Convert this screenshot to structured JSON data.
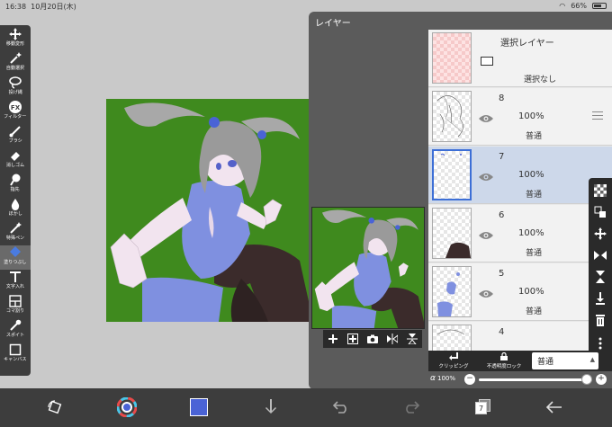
{
  "status_bar": {
    "time": "16:38",
    "date": "10月20日(木)",
    "battery": "66%"
  },
  "toolbar": {
    "items": [
      {
        "icon": "move-icon",
        "label": "移動変形"
      },
      {
        "icon": "magic-wand-icon",
        "label": "自動選択"
      },
      {
        "icon": "lasso-icon",
        "label": "投げ縄"
      },
      {
        "icon": "fx-icon",
        "label": "フィルター"
      },
      {
        "icon": "brush-icon",
        "label": "ブラシ"
      },
      {
        "icon": "eraser-icon",
        "label": "消しゴム"
      },
      {
        "icon": "smudge-icon",
        "label": "指先"
      },
      {
        "icon": "blur-icon",
        "label": "ぼかし"
      },
      {
        "icon": "special-pen-icon",
        "label": "特殊ペン"
      },
      {
        "icon": "fill-icon",
        "label": "塗りつぶし"
      },
      {
        "icon": "text-icon",
        "label": "文字入れ"
      },
      {
        "icon": "frame-divide-icon",
        "label": "コマ割り"
      },
      {
        "icon": "eyedropper-icon",
        "label": "スポイト"
      },
      {
        "icon": "canvas-icon",
        "label": "キャンバス"
      }
    ],
    "active_index": 9
  },
  "layer_panel": {
    "title": "レイヤー",
    "selection_layer": {
      "title": "選択レイヤー",
      "status": "選択なし"
    },
    "layers": [
      {
        "number": "8",
        "opacity": "100%",
        "blend": "普通",
        "selected": false
      },
      {
        "number": "7",
        "opacity": "100%",
        "blend": "普通",
        "selected": true
      },
      {
        "number": "6",
        "opacity": "100%",
        "blend": "普通",
        "selected": false
      },
      {
        "number": "5",
        "opacity": "100%",
        "blend": "普通",
        "selected": false
      },
      {
        "number": "4",
        "opacity": "",
        "blend": "",
        "selected": false
      }
    ],
    "clipping_label": "クリッピング",
    "lock_label": "不透明度ロック",
    "blend_mode": "普通",
    "opacity_symbol": "α",
    "opacity_value": "100%",
    "opacity_fraction": 1.0
  },
  "colors": {
    "canvas_bg": "#3f8a1e",
    "current_color": "#4a63d6",
    "selection_accent": "#3d6fd6"
  },
  "bottom_bar": {
    "icons": [
      "transform-icon",
      "color-wheel-icon",
      "current-color-swatch",
      "download-icon",
      "undo-icon",
      "redo-icon",
      "layers-count-icon",
      "back-icon"
    ],
    "layer_count": "7"
  }
}
